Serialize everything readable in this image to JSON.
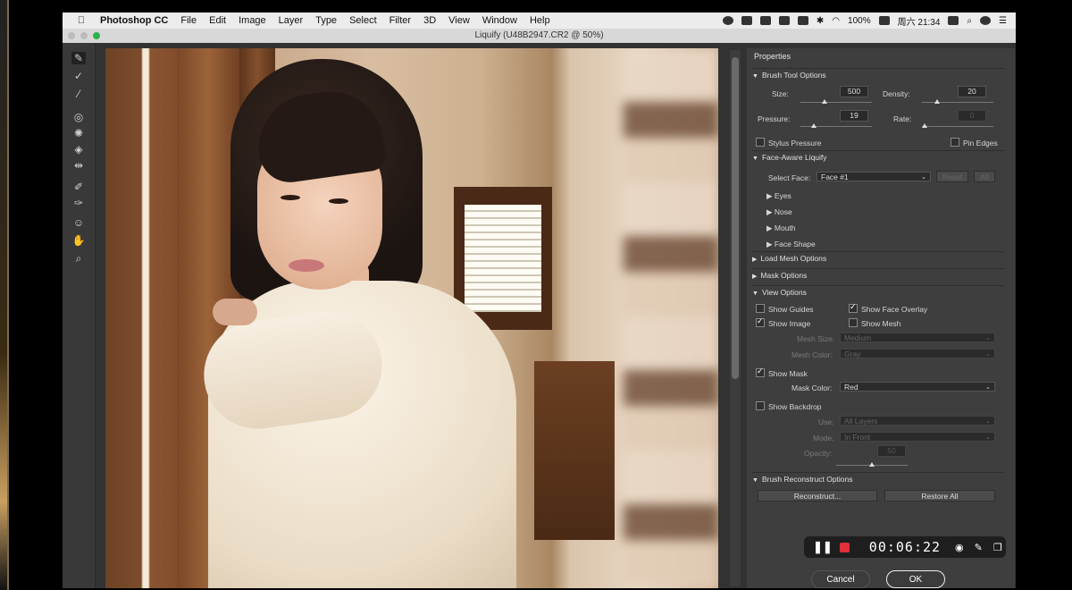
{
  "menubar": {
    "app_name": "Photoshop CC",
    "items": [
      "File",
      "Edit",
      "Image",
      "Layer",
      "Type",
      "Select",
      "Filter",
      "3D",
      "View",
      "Window",
      "Help"
    ],
    "battery": "100%",
    "clock": "周六 21:34"
  },
  "window": {
    "title": "Liquify (U48B2947.CR2 @ 50%)"
  },
  "panel": {
    "title": "Properties",
    "brush_tool": {
      "header": "Brush Tool Options",
      "size_label": "Size:",
      "size_value": "500",
      "density_label": "Density:",
      "density_value": "20",
      "pressure_label": "Pressure:",
      "pressure_value": "19",
      "rate_label": "Rate:",
      "rate_value": "0",
      "stylus_pressure": "Stylus Pressure",
      "pin_edges": "Pin Edges"
    },
    "face_aware": {
      "header": "Face-Aware Liquify",
      "select_face_label": "Select Face:",
      "select_face_value": "Face #1",
      "reset": "Reset",
      "all": "All",
      "items": [
        "Eyes",
        "Nose",
        "Mouth",
        "Face Shape"
      ]
    },
    "load_mesh": "Load Mesh Options",
    "mask_options": "Mask Options",
    "view_options": {
      "header": "View Options",
      "show_guides": "Show Guides",
      "show_face_overlay": "Show Face Overlay",
      "show_image": "Show Image",
      "show_mesh": "Show Mesh",
      "mesh_size_label": "Mesh Size:",
      "mesh_size_value": "Medium",
      "mesh_color_label": "Mesh Color:",
      "mesh_color_value": "Gray",
      "show_mask": "Show Mask",
      "mask_color_label": "Mask Color:",
      "mask_color_value": "Red",
      "show_backdrop": "Show Backdrop",
      "use_label": "Use:",
      "use_value": "All Layers",
      "mode_label": "Mode:",
      "mode_value": "In Front",
      "opacity_label": "Opacity:",
      "opacity_value": "50"
    },
    "reconstruct": {
      "header": "Brush Reconstruct Options",
      "reconstruct": "Reconstruct...",
      "restore_all": "Restore All"
    }
  },
  "recorder": {
    "time": "00:06:22"
  },
  "dialog": {
    "cancel": "Cancel",
    "ok": "OK"
  },
  "colors": {
    "panel_bg": "#3e3e3e",
    "record_red": "#e0303a"
  }
}
